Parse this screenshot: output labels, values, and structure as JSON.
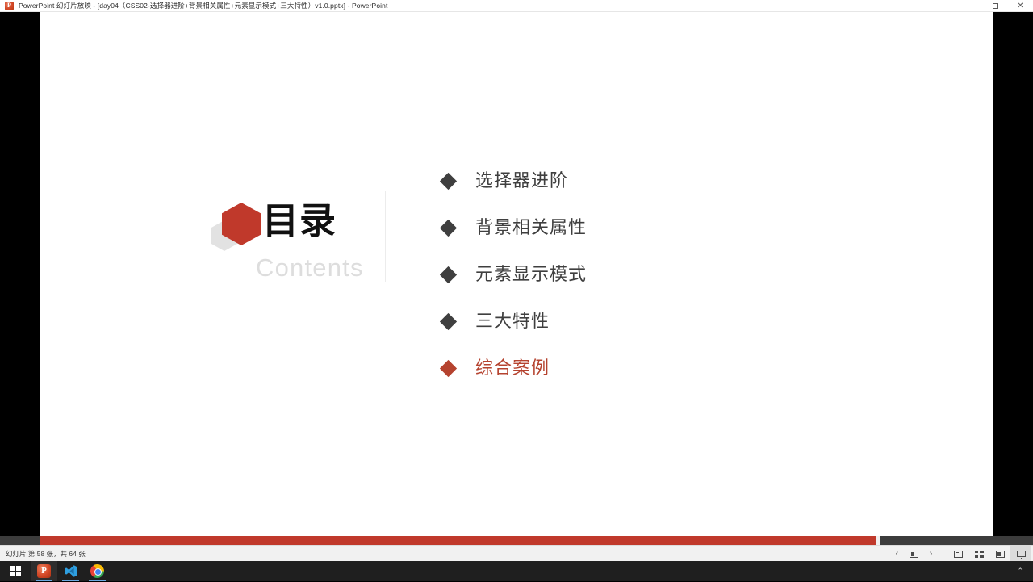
{
  "window": {
    "title": "PowerPoint 幻灯片放映 - [day04（CSS02-选择器进阶+背景相关属性+元素显示模式+三大特性）v1.0.pptx] - PowerPoint",
    "app_icon": "powerpoint-icon",
    "controls": {
      "minimize": "minimize-icon",
      "maximize": "maximize-icon",
      "close": "close-icon"
    }
  },
  "slide": {
    "heading_cn": "目录",
    "heading_en": "Contents",
    "logo": {
      "name": "hexagon-logo",
      "red": "#c0392b",
      "gray": "#e0e0e0"
    },
    "items": [
      {
        "label": "选择器进阶",
        "color": "#3f3f3f",
        "bullet_color": "#3f3f3f",
        "active": false
      },
      {
        "label": "背景相关属性",
        "color": "#3f3f3f",
        "bullet_color": "#3f3f3f",
        "active": false
      },
      {
        "label": "元素显示模式",
        "color": "#3f3f3f",
        "bullet_color": "#3f3f3f",
        "active": false
      },
      {
        "label": "三大特性",
        "color": "#3f3f3f",
        "bullet_color": "#3f3f3f",
        "active": false
      },
      {
        "label": "综合案例",
        "color": "#b5432f",
        "bullet_color": "#b5432f",
        "active": true
      }
    ]
  },
  "progress": {
    "fill_color": "#c0392b",
    "track_color": "#3c3c3c",
    "percent": 88
  },
  "statusbar": {
    "slide_text": "幻灯片 第 58 张，共 64 张",
    "prev_label": "‹",
    "next_label": "›",
    "views": [
      {
        "name": "view-normal",
        "label": "普通视图",
        "active": false
      },
      {
        "name": "view-sorter",
        "label": "幻灯片浏览",
        "active": false
      },
      {
        "name": "view-reading",
        "label": "阅读视图",
        "active": false
      },
      {
        "name": "view-show",
        "label": "幻灯片放映",
        "active": true
      }
    ]
  },
  "taskbar": {
    "start": "windows-start-icon",
    "apps": [
      {
        "name": "taskbar-powerpoint",
        "icon": "powerpoint-icon",
        "running": true,
        "focus": true
      },
      {
        "name": "taskbar-vscode",
        "icon": "vscode-icon",
        "running": true,
        "focus": false
      },
      {
        "name": "taskbar-chrome",
        "icon": "chrome-icon",
        "running": true,
        "focus": false
      }
    ],
    "tray_expand": "show-hidden-icons-chevron"
  }
}
